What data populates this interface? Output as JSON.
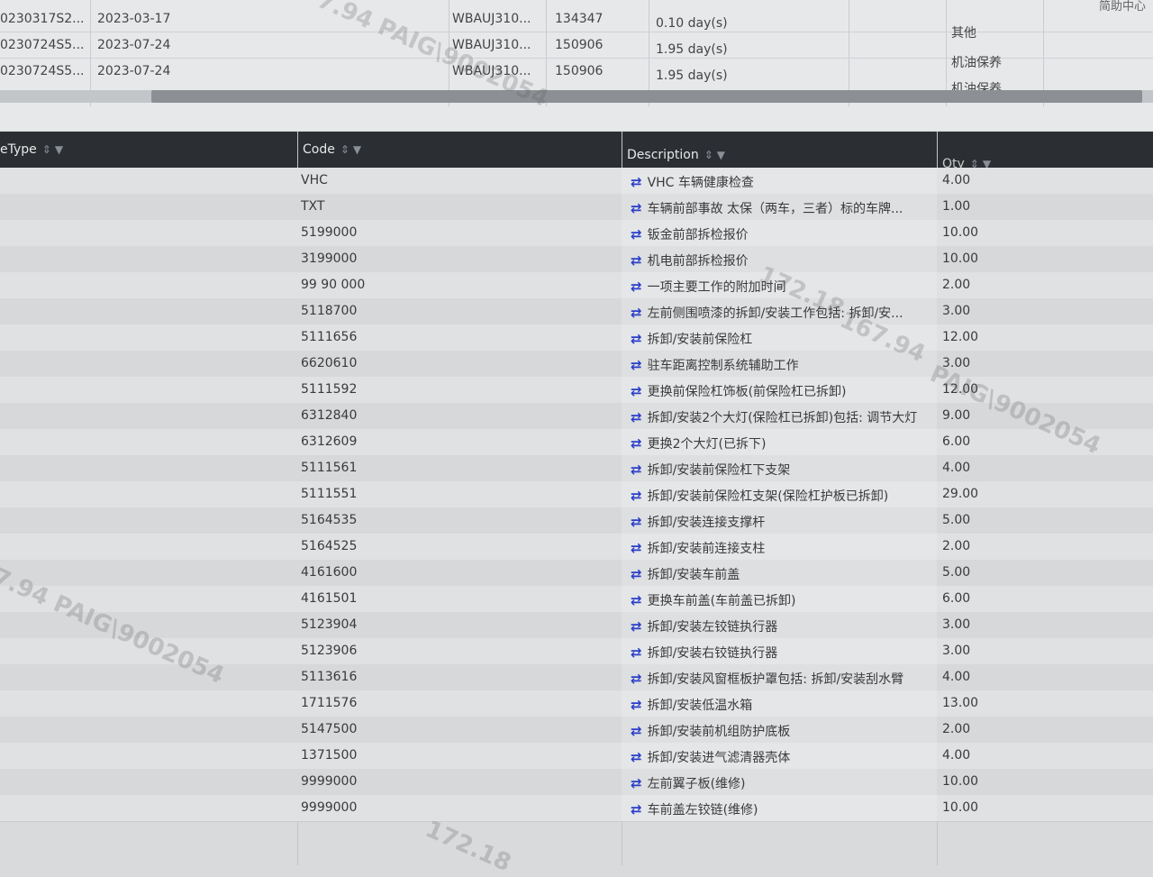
{
  "top_table": {
    "corner_text": "简助中心",
    "rows": [
      {
        "order": "0230317S2...",
        "date": "2023-03-17",
        "vin": "WBAUJ310...",
        "mileage": "134347",
        "duration": "0.10 day(s)",
        "note": "其他"
      },
      {
        "order": "0230724S5...",
        "date": "2023-07-24",
        "vin": "WBAUJ310...",
        "mileage": "150906",
        "duration": "1.95 day(s)",
        "note": "机油保养"
      },
      {
        "order": "0230724S5...",
        "date": "2023-07-24",
        "vin": "WBAUJ310...",
        "mileage": "150906",
        "duration": "1.95 day(s)",
        "note": "机油保养"
      }
    ]
  },
  "columns": {
    "type": "eType",
    "code": "Code",
    "description": "Description",
    "qty": "Qty"
  },
  "icons": {
    "sort": "sort-icon",
    "filter": "filter-icon",
    "swap": "swap-arrows-icon"
  },
  "colors": {
    "header_bg": "#2b2e33",
    "swap_icon": "#2a3ec8"
  },
  "rows": [
    {
      "code": "VHC",
      "description": "VHC 车辆健康检查",
      "qty": "4.00"
    },
    {
      "code": "TXT",
      "description": "车辆前部事故 太保（两车，三者）标的车牌...",
      "qty": "1.00"
    },
    {
      "code": "5199000",
      "description": "钣金前部拆检报价",
      "qty": "10.00"
    },
    {
      "code": "3199000",
      "description": "机电前部拆检报价",
      "qty": "10.00"
    },
    {
      "code": "99 90 000",
      "description": "一项主要工作的附加时间",
      "qty": "2.00"
    },
    {
      "code": "5118700",
      "description": "左前侧围喷漆的拆卸/安装工作包括: 拆卸/安...",
      "qty": "3.00"
    },
    {
      "code": "5111656",
      "description": "拆卸/安装前保险杠",
      "qty": "12.00"
    },
    {
      "code": "6620610",
      "description": "驻车距离控制系统辅助工作",
      "qty": "3.00"
    },
    {
      "code": "5111592",
      "description": "更换前保险杠饰板(前保险杠已拆卸)",
      "qty": "12.00"
    },
    {
      "code": "6312840",
      "description": "拆卸/安装2个大灯(保险杠已拆卸)包括: 调节大灯",
      "qty": "9.00"
    },
    {
      "code": "6312609",
      "description": "更换2个大灯(已拆下)",
      "qty": "6.00"
    },
    {
      "code": "5111561",
      "description": "拆卸/安装前保险杠下支架",
      "qty": "4.00"
    },
    {
      "code": "5111551",
      "description": "拆卸/安装前保险杠支架(保险杠护板已拆卸)",
      "qty": "29.00"
    },
    {
      "code": "5164535",
      "description": "拆卸/安装连接支撑杆",
      "qty": "5.00"
    },
    {
      "code": "5164525",
      "description": "拆卸/安装前连接支柱",
      "qty": "2.00"
    },
    {
      "code": "4161600",
      "description": "拆卸/安装车前盖",
      "qty": "5.00"
    },
    {
      "code": "4161501",
      "description": "更换车前盖(车前盖已拆卸)",
      "qty": "6.00"
    },
    {
      "code": "5123904",
      "description": "拆卸/安装左铰链执行器",
      "qty": "3.00"
    },
    {
      "code": "5123906",
      "description": "拆卸/安装右铰链执行器",
      "qty": "3.00"
    },
    {
      "code": "5113616",
      "description": "拆卸/安装风窗框板护罩包括: 拆卸/安装刮水臂",
      "qty": "4.00"
    },
    {
      "code": "1711576",
      "description": "拆卸/安装低温水箱",
      "qty": "13.00"
    },
    {
      "code": "5147500",
      "description": "拆卸/安装前机组防护底板",
      "qty": "2.00"
    },
    {
      "code": "1371500",
      "description": "拆卸/安装进气滤清器壳体",
      "qty": "4.00"
    },
    {
      "code": "9999000",
      "description": "左前翼子板(维修)",
      "qty": "10.00"
    },
    {
      "code": "9999000",
      "description": "车前盖左铰链(维修)",
      "qty": "10.00"
    }
  ],
  "watermarks": [
    "7.94 PAIG\\9002054",
    "172.18",
    "167.94",
    "PAIG\\9002054",
    "7.94 PAIG\\9002054",
    "172.18"
  ]
}
